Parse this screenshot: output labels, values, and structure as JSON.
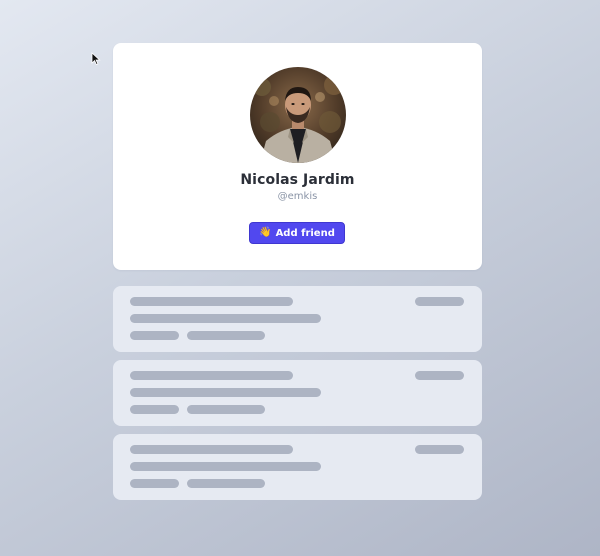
{
  "profile": {
    "name": "Nicolas Jardim",
    "handle": "@emkis",
    "add_friend_label": "Add friend",
    "add_friend_icon": "waving-hand-icon",
    "add_friend_emoji": "👋",
    "avatar_icon": "user-photo-avatar"
  },
  "skeleton_cards": {
    "count": 3,
    "placeholder_color": "#adb4c3",
    "card_color": "#e6eaf2"
  },
  "colors": {
    "accent": "#5148ef",
    "name_text": "#2b2f38",
    "handle_text": "#8a94a6",
    "card_background": "#ffffff"
  }
}
